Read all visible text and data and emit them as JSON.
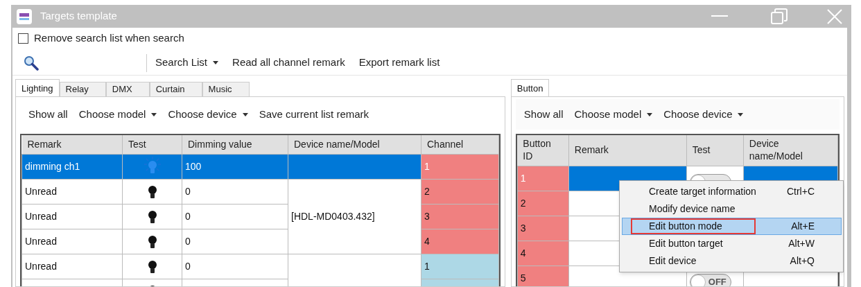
{
  "window": {
    "title": "Targets template"
  },
  "options": {
    "remove_search_list": {
      "label": "Remove search list when search",
      "checked": false
    }
  },
  "toolbar": {
    "items": [
      {
        "label": "Search List",
        "dropdown": true
      },
      {
        "label": "Read all channel remark",
        "dropdown": false
      },
      {
        "label": "Export remark list",
        "dropdown": false
      }
    ]
  },
  "left_panel": {
    "tabs": [
      {
        "label": "Lighting",
        "selected": true
      },
      {
        "label": "Relay",
        "selected": false
      },
      {
        "label": "DMX",
        "selected": false
      },
      {
        "label": "Curtain",
        "selected": false
      },
      {
        "label": "Music",
        "selected": false
      }
    ],
    "toolbar": [
      {
        "label": "Show all",
        "dropdown": false
      },
      {
        "label": "Choose model",
        "dropdown": true
      },
      {
        "label": "Choose device",
        "dropdown": true
      },
      {
        "label": "Save current list remark",
        "dropdown": false
      }
    ],
    "table": {
      "columns": [
        "Remark",
        "Test",
        "Dimming value",
        "Device name/Model",
        "Channel"
      ],
      "groups": [
        {
          "rows": [
            {
              "remark": "dimming ch1",
              "lit": true,
              "value": "100",
              "channel": "1",
              "color": "#f08080",
              "selected": true
            }
          ]
        },
        {
          "device": "[HDL-MD0403.432]",
          "rows": [
            {
              "remark": "Unread",
              "lit": false,
              "value": "0",
              "channel": "2",
              "color": "#f08080",
              "selected": false
            },
            {
              "remark": "Unread",
              "lit": false,
              "value": "0",
              "channel": "3",
              "color": "#f08080",
              "selected": false
            },
            {
              "remark": "Unread",
              "lit": false,
              "value": "0",
              "channel": "4",
              "color": "#f08080",
              "selected": false
            }
          ]
        },
        {
          "rows": [
            {
              "remark": "Unread",
              "lit": false,
              "value": "0",
              "channel": "1",
              "color": "#add8e6",
              "selected": false
            },
            {
              "lit": false,
              "color": "#add8e6",
              "selected": false
            }
          ]
        }
      ]
    }
  },
  "right_panel": {
    "tabs": [
      {
        "label": "Button",
        "selected": true
      }
    ],
    "toolbar": [
      {
        "label": "Show all",
        "dropdown": false
      },
      {
        "label": "Choose model",
        "dropdown": true
      },
      {
        "label": "Choose device",
        "dropdown": true
      }
    ],
    "table": {
      "columns": [
        "Button ID",
        "Remark",
        "Test",
        "Device name/Model"
      ],
      "rows": [
        {
          "id": "1",
          "selected": true,
          "toggle": {
            "on": false
          }
        },
        {
          "id": "2",
          "selected": false
        },
        {
          "id": "3",
          "selected": false
        },
        {
          "id": "4",
          "selected": false
        },
        {
          "id": "5",
          "selected": false,
          "toggle": {
            "on": false,
            "label": "OFF"
          }
        }
      ]
    }
  },
  "context_menu": {
    "items": [
      {
        "label": "Create target information",
        "shortcut": "Ctrl+C",
        "selected": false,
        "marked": false
      },
      {
        "label": "Modify device name",
        "selected": false,
        "marked": false
      },
      {
        "label": "Edit button mode",
        "shortcut": "Alt+E",
        "selected": true,
        "marked": true
      },
      {
        "label": "Edit button target",
        "shortcut": "Alt+W",
        "selected": false,
        "marked": false
      },
      {
        "label": "Edit device",
        "shortcut": "Alt+Q",
        "selected": false,
        "marked": false
      }
    ]
  }
}
